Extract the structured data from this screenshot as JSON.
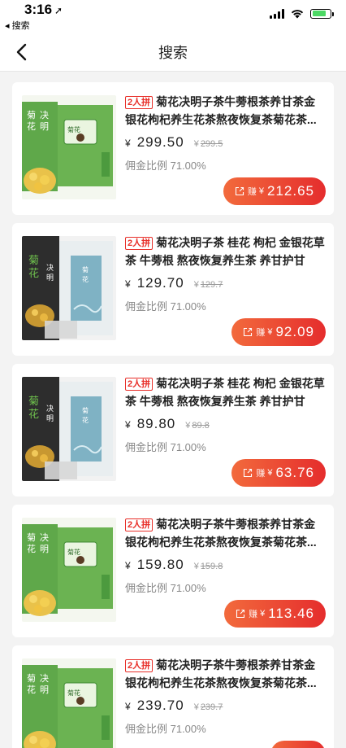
{
  "status_bar": {
    "time": "3:16",
    "back_app": "◂ 搜索"
  },
  "nav": {
    "title": "搜索"
  },
  "labels": {
    "yen": "¥",
    "earn": "赚"
  },
  "products": [
    {
      "tag": "2人拼",
      "title": "菊花决明子茶牛蒡根茶养甘茶金银花枸杞养生花茶熬夜恢复茶菊花茶...",
      "price": "299.50",
      "old_price": "299.5",
      "commission": "佣金比例 71.00%",
      "earn": "212.65",
      "image": "green-box"
    },
    {
      "tag": "2人拼",
      "title": "菊花决明子茶 桂花 枸杞 金银花草茶 牛蒡根 熬夜恢复养生茶 养甘护甘茶...",
      "price": "129.70",
      "old_price": "129.7",
      "commission": "佣金比例 71.00%",
      "earn": "92.09",
      "image": "blue-box"
    },
    {
      "tag": "2人拼",
      "title": "菊花决明子茶 桂花 枸杞 金银花草茶 牛蒡根 熬夜恢复养生茶 养甘护甘茶...",
      "price": "89.80",
      "old_price": "89.8",
      "commission": "佣金比例 71.00%",
      "earn": "63.76",
      "image": "blue-box"
    },
    {
      "tag": "2人拼",
      "title": "菊花决明子茶牛蒡根茶养甘茶金银花枸杞养生花茶熬夜恢复茶菊花茶...",
      "price": "159.80",
      "old_price": "159.8",
      "commission": "佣金比例 71.00%",
      "earn": "113.46",
      "image": "green-box"
    },
    {
      "tag": "2人拼",
      "title": "菊花决明子茶牛蒡根茶养甘茶金银花枸杞养生花茶熬夜恢复茶菊花茶...",
      "price": "239.70",
      "old_price": "239.7",
      "commission": "佣金比例 71.00%",
      "earn": "",
      "image": "green-box"
    }
  ],
  "colors": {
    "accent": "#e8302a",
    "button_start": "#f26a3c",
    "button_end": "#e52d2d",
    "background": "#f3f3f3"
  }
}
